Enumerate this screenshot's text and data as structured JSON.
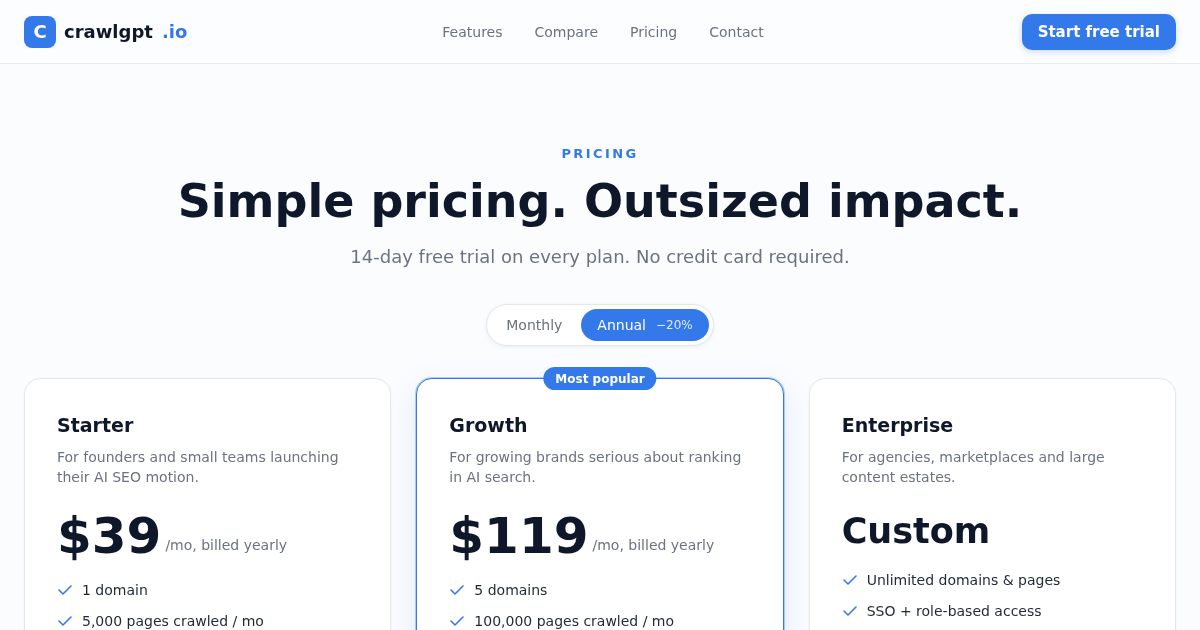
{
  "header": {
    "logo": {
      "mark": "C",
      "name": "crawlgpt",
      "suffix": ".io"
    },
    "nav": [
      "Features",
      "Compare",
      "Pricing",
      "Contact"
    ],
    "cta": "Start free trial"
  },
  "hero": {
    "eyebrow": "PRICING",
    "title": "Simple pricing. Outsized impact.",
    "subtitle": "14-day free trial on every plan. No credit card required."
  },
  "billing_toggle": {
    "options": [
      {
        "label": "Monthly",
        "selected": false
      },
      {
        "label": "Annual",
        "discount": "−20%",
        "selected": true
      }
    ]
  },
  "plans": [
    {
      "name": "Starter",
      "featured": false,
      "description": "For founders and small teams launching their AI SEO motion.",
      "price": {
        "kind": "amount",
        "value": "$39",
        "period": "/mo, billed yearly"
      },
      "features": [
        "1 domain",
        "5,000 pages crawled / mo"
      ]
    },
    {
      "name": "Growth",
      "featured": true,
      "badge": "Most popular",
      "description": "For growing brands serious about ranking in AI search.",
      "price": {
        "kind": "amount",
        "value": "$119",
        "period": "/mo, billed yearly"
      },
      "features": [
        "5 domains",
        "100,000 pages crawled / mo"
      ]
    },
    {
      "name": "Enterprise",
      "featured": false,
      "description": "For agencies, marketplaces and large content estates.",
      "price": {
        "kind": "custom",
        "value": "Custom"
      },
      "features": [
        "Unlimited domains & pages",
        "SSO + role-based access"
      ]
    }
  ]
}
